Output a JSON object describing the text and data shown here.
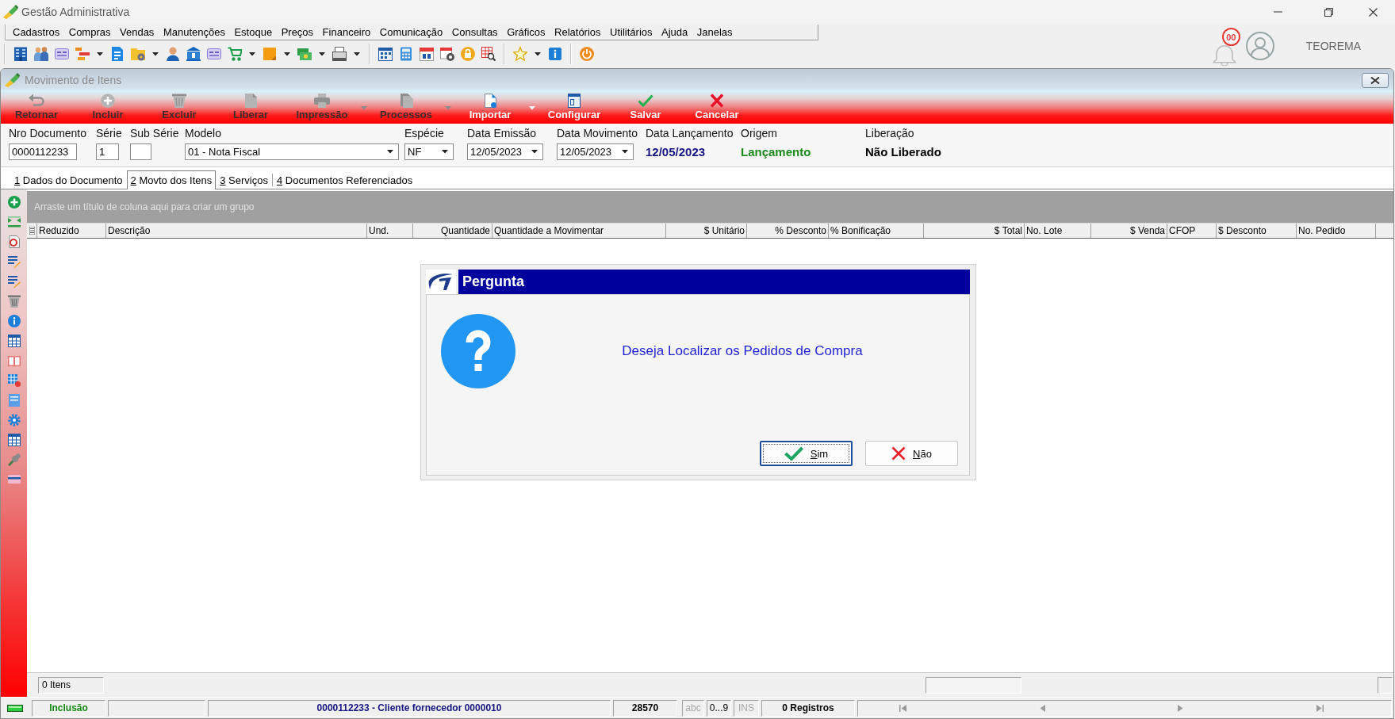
{
  "window": {
    "title": "Gestão Administrativa"
  },
  "menu": [
    "Cadastros",
    "Compras",
    "Vendas",
    "Manutenções",
    "Estoque",
    "Preços",
    "Financeiro",
    "Comunicação",
    "Consultas",
    "Gráficos",
    "Relatórios",
    "Utilitários",
    "Ajuda",
    "Janelas"
  ],
  "notifications": {
    "count": "00"
  },
  "user": {
    "name": "TEOREMA"
  },
  "document_window": {
    "title": "Movimento de Itens",
    "actions": [
      {
        "label": "Retornar",
        "kind": "button",
        "disabled": true
      },
      {
        "label": "Incluir",
        "kind": "button",
        "disabled": true
      },
      {
        "label": "Excluir",
        "kind": "button",
        "disabled": true
      },
      {
        "label": "Liberar",
        "kind": "button",
        "disabled": true
      },
      {
        "label": "Impressão",
        "kind": "split",
        "disabled": true
      },
      {
        "label": "Processos",
        "kind": "split",
        "disabled": true
      },
      {
        "label": "Importar",
        "kind": "split",
        "disabled": false
      },
      {
        "label": "Configurar",
        "kind": "button",
        "disabled": false
      },
      {
        "label": "Salvar",
        "kind": "button",
        "disabled": false
      },
      {
        "label": "Cancelar",
        "kind": "button",
        "disabled": false
      }
    ],
    "fields": [
      {
        "label": "Nro Documento",
        "kind": "text",
        "value": "0000112233"
      },
      {
        "label": "Série",
        "kind": "text",
        "value": "1"
      },
      {
        "label": "Sub Série",
        "kind": "text"
      },
      {
        "label": "Modelo",
        "kind": "select",
        "value": "01 - Nota Fiscal"
      },
      {
        "label": "Espécie",
        "kind": "select",
        "value": "NF"
      },
      {
        "label": "Data Emissão",
        "kind": "select",
        "value": "12/05/2023"
      },
      {
        "label": "Data Movimento",
        "kind": "select",
        "value": "12/05/2023"
      },
      {
        "label": "Data Lançamento",
        "kind": "display",
        "value": "12/05/2023",
        "color": "#141480"
      },
      {
        "label": "Origem",
        "kind": "display",
        "value": "Lançamento",
        "color": "#1a8a1a"
      },
      {
        "label": "Liberação",
        "kind": "display",
        "value": "Não Liberado",
        "color": "#000000"
      }
    ],
    "tabs": [
      {
        "label": "1 Dados do Documento",
        "selected": false
      },
      {
        "label": "2 Movto dos Itens",
        "selected": true
      },
      {
        "label": "3 Serviços",
        "selected": false
      },
      {
        "label": "4 Documentos Referenciados",
        "selected": false
      }
    ],
    "grid": {
      "group_hint": "Arraste um título de coluna aqui para criar um grupo",
      "columns": [
        "Reduzido",
        "Descrição",
        "Und.",
        "Quantidade",
        "Quantidade a Movimentar",
        "$ Unitário",
        "% Desconto",
        "% Bonificação",
        "$ Total",
        "No. Lote",
        "$ Venda",
        "CFOP",
        "$ Desconto",
        "No. Pedido"
      ],
      "footer": "0 Itens"
    },
    "status_bar": {
      "mode": "Inclusão",
      "document": "0000112233 - Cliente fornecedor 0000010",
      "code": "28570",
      "indicators": [
        {
          "label": "abc",
          "on": false
        },
        {
          "label": "0...9",
          "on": true
        },
        {
          "label": "INS",
          "on": false
        }
      ],
      "records": "0 Registros"
    }
  },
  "dialog": {
    "title": "Pergunta",
    "message": "Deseja Localizar os Pedidos de Compra",
    "buttons": [
      {
        "label": "Sim",
        "kind": "confirm",
        "focused": true
      },
      {
        "label": "Não",
        "kind": "cancel",
        "focused": false
      }
    ]
  }
}
